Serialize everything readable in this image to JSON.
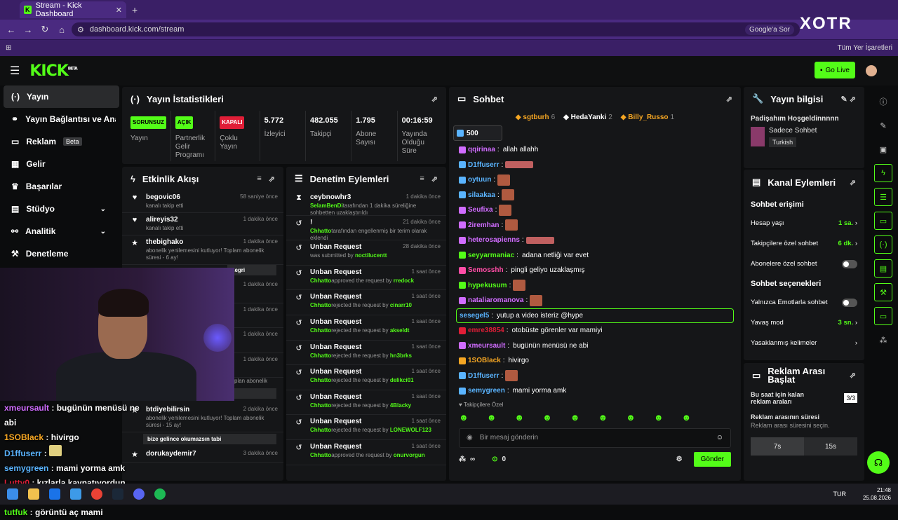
{
  "browser": {
    "tab_title": "Stream - Kick Dashboard",
    "url": "dashboard.kick.com/stream",
    "google_search": "Google'a Sor",
    "bookmarks_all": "Tüm Yer İşaretleri"
  },
  "watermark": "XOTR",
  "header": {
    "logo": "KICK",
    "beta": "BETA",
    "go_live": "Go Live"
  },
  "sidebar": {
    "items": [
      {
        "label": "Yayın",
        "icon": "broadcast-icon"
      },
      {
        "label": "Yayın Bağlantısı ve Anahtarı",
        "icon": "link-icon"
      },
      {
        "label": "Reklam",
        "badge": "Beta",
        "icon": "ad-icon"
      },
      {
        "label": "Gelir",
        "icon": "revenue-icon"
      },
      {
        "label": "Başarılar",
        "icon": "trophy-icon"
      },
      {
        "label": "Stüdyo",
        "icon": "studio-icon"
      },
      {
        "label": "Analitik",
        "icon": "chart-icon"
      },
      {
        "label": "Denetleme",
        "icon": "wrench-icon"
      }
    ]
  },
  "stats": {
    "title": "Yayın İstatistikleri",
    "cells": [
      {
        "badge": "SORUNSUZ",
        "label": "Yayın",
        "color": "#53fc18"
      },
      {
        "badge": "AÇIK",
        "label": "Partnerlik Gelir Programı",
        "color": "#53fc18"
      },
      {
        "badge": "KAPALI",
        "label": "Çoklu Yayın",
        "color": "#e01e37"
      },
      {
        "value": "5.772",
        "label": "İzleyici"
      },
      {
        "value": "482.055",
        "label": "Takipçi"
      },
      {
        "value": "1.795",
        "label": "Abone Sayısı"
      },
      {
        "value": "00:16:59",
        "label": "Yayında Olduğu Süre"
      }
    ]
  },
  "feed": {
    "title": "Etkinlik Akışı",
    "items": [
      {
        "user": "begovic06",
        "time": "58 saniye önce",
        "text": "kanalı takip etti"
      },
      {
        "user": "alireyis32",
        "time": "1 dakika önce",
        "text": "kanalı takip etti"
      },
      {
        "user": "thebighako",
        "time": "1 dakika önce",
        "text": "abonelik yenilemesini kutluyor! Toplam abonelik süresi - 6 ay!"
      }
    ],
    "quote1": "kegri",
    "times": [
      "1 dakika önce",
      "1 dakika önce",
      "1 dakika önce",
      "1 dakika önce"
    ],
    "plan_text": "plan abonelik",
    "quote2": "Sa abimm iyi yayınlarrr",
    "item_last": {
      "user": "btdiyebilirsin",
      "time": "2 dakika önce",
      "text": "abonelik yenilemesini kutluyor! Toplam abonelik süresi - 15 ay!"
    },
    "quote3": "bize gelince okumazsın tabi",
    "item_cut": {
      "user": "dorukaydemir7",
      "time": "3 dakika önce"
    }
  },
  "mod": {
    "title": "Denetim Eylemleri",
    "items": [
      {
        "title": "ceybnowhr3",
        "time": "1 dakika önce",
        "by": "SelamBenDi",
        "text": "tarafından 1 dakika süreliğine sohbetten uzaklaştırıldı"
      },
      {
        "title": "!",
        "time": "21 dakika önce",
        "by": "Chhatto",
        "text": "tarafından engellenmiş bir terim olarak eklendi"
      },
      {
        "title": "Unban Request",
        "time": "28 dakika önce",
        "pre": "was submitted by ",
        "by": "noctilucentt"
      },
      {
        "title": "Unban Request",
        "time": "1 saat önce",
        "by": "Chhatto",
        "text": "approved the request by ",
        "target": "rredock"
      },
      {
        "title": "Unban Request",
        "time": "1 saat önce",
        "by": "Chhatto",
        "text": "rejected the request by ",
        "target": "cinarr10"
      },
      {
        "title": "Unban Request",
        "time": "1 saat önce",
        "by": "Chhatto",
        "text": "rejected the request by ",
        "target": "akseldt"
      },
      {
        "title": "Unban Request",
        "time": "1 saat önce",
        "by": "Chhatto",
        "text": "rejected the request by ",
        "target": "hn3brks"
      },
      {
        "title": "Unban Request",
        "time": "1 saat önce",
        "by": "Chhatto",
        "text": "rejected the request by ",
        "target": "delikci01"
      },
      {
        "title": "Unban Request",
        "time": "1 saat önce",
        "by": "Chhatto",
        "text": "rejected the request by ",
        "target": "4Blacky"
      },
      {
        "title": "Unban Request",
        "time": "1 saat önce",
        "by": "Chhatto",
        "text": "rejected the request by ",
        "target": "LONEWOLF123"
      },
      {
        "title": "Unban Request",
        "time": "1 saat önce",
        "by": "Chhatto",
        "text": "approved the request by ",
        "target": "onurvorgun"
      }
    ]
  },
  "chat": {
    "title": "Sohbet",
    "pinned": [
      {
        "user": "sgtburh",
        "count": "6",
        "color": "#f5a623"
      },
      {
        "user": "HedaYanki",
        "count": "2",
        "color": "#ffffff"
      },
      {
        "user": "Billy_Russo",
        "count": "1",
        "color": "#f5a623"
      }
    ],
    "viewer_count": "500",
    "messages": [
      {
        "user": "qqirinaa",
        "text": "allah allahh",
        "color": "#d06cff"
      },
      {
        "user": "D1ffuserr",
        "text": "",
        "color": "#5ab4ff",
        "emote": "wide"
      },
      {
        "user": "oytuun",
        "text": "",
        "color": "#5ab4ff",
        "emote": "sq"
      },
      {
        "user": "silaakaa",
        "text": "",
        "color": "#5ab4ff",
        "emote": "sq"
      },
      {
        "user": "Seufixa",
        "text": "",
        "color": "#d06cff",
        "emote": "sq"
      },
      {
        "user": "2iremhan",
        "text": "",
        "color": "#d06cff",
        "emote": "sq"
      },
      {
        "user": "heterosapienns",
        "text": "",
        "color": "#d06cff",
        "emote": "wide"
      },
      {
        "user": "seyyarmaniac",
        "text": "adana netliği var evet",
        "color": "#53fc18"
      },
      {
        "user": "Semosshh",
        "text": "pingli geliyo uzaklaşmış",
        "color": "#ff4da6"
      },
      {
        "user": "hypekusum",
        "text": "",
        "color": "#53fc18",
        "emote": "sq"
      },
      {
        "user": "nataliaromanova",
        "text": "",
        "color": "#d06cff",
        "emote": "sq"
      },
      {
        "user": "sesegel5",
        "text": "yutup a video isteriz @hype",
        "color": "#5ab4ff",
        "highlight": true
      },
      {
        "user": "emre38854",
        "text": "otobüste görenler var mamiyi",
        "color": "#e01e37"
      },
      {
        "user": "xmeursault",
        "text": "bugünün menüsü ne abi",
        "color": "#d06cff"
      },
      {
        "user": "1SOBlack",
        "text": "hivirgo",
        "color": "#f5a623"
      },
      {
        "user": "D1ffuserr",
        "text": "",
        "color": "#5ab4ff",
        "emote": "sq"
      },
      {
        "user": "semygreen",
        "text": "mami yorma amk",
        "color": "#5ab4ff"
      }
    ],
    "follower_only": "Takipçilere Özel",
    "placeholder": "Bir mesaj gönderin",
    "loop": "∞",
    "points": "0",
    "send": "Gönder"
  },
  "info": {
    "title": "Yayın bilgisi",
    "stream_title": "Padişahım Hoşgeldinnnnn",
    "category": "Sadece Sohbet",
    "language": "Turkish"
  },
  "channel": {
    "title": "Kanal Eylemleri",
    "chat_access": "Sohbet erişimi",
    "account_age": "Hesap yaşı",
    "account_age_val": "1 sa.",
    "follower_only": "Takipçilere özel sohbet",
    "follower_only_val": "6 dk.",
    "sub_only": "Abonelere özel sohbet",
    "chat_options": "Sohbet seçenekleri",
    "emote_only": "Yalnızca Emotlarla sohbet",
    "slow_mode": "Yavaş mod",
    "slow_mode_val": "3 sn.",
    "banned_words": "Yasaklanmış kelimeler"
  },
  "ads": {
    "title": "Reklam Arası Başlat",
    "remaining_label": "Bu saat için kalan reklam araları",
    "remaining_val": "3/3",
    "duration_label": "Reklam arasının süresi",
    "duration_hint": "Reklam arası süresini seçin.",
    "options": [
      "7s",
      "15s"
    ]
  },
  "overlay": [
    {
      "user": "xmeursault",
      "text": "bugünün menüsü ne abi",
      "color": "#d06cff"
    },
    {
      "user": "1SOBlack",
      "text": "hivirgo",
      "color": "#f5a623"
    },
    {
      "user": "D1ffuserr",
      "text": "",
      "color": "#5ab4ff"
    },
    {
      "user": "semygreen",
      "text": "mami yorma amk",
      "color": "#5ab4ff"
    },
    {
      "user": "Lutty0",
      "text": "kızlarla kaynatıyordun storilerden gördük",
      "color": "#e01e37"
    },
    {
      "user": "tutfuk",
      "text": "görüntü aç mami",
      "color": "#53fc18"
    }
  ],
  "taskbar": {
    "time": "21:48",
    "date": "25.08.2026",
    "lang": "TUR"
  }
}
